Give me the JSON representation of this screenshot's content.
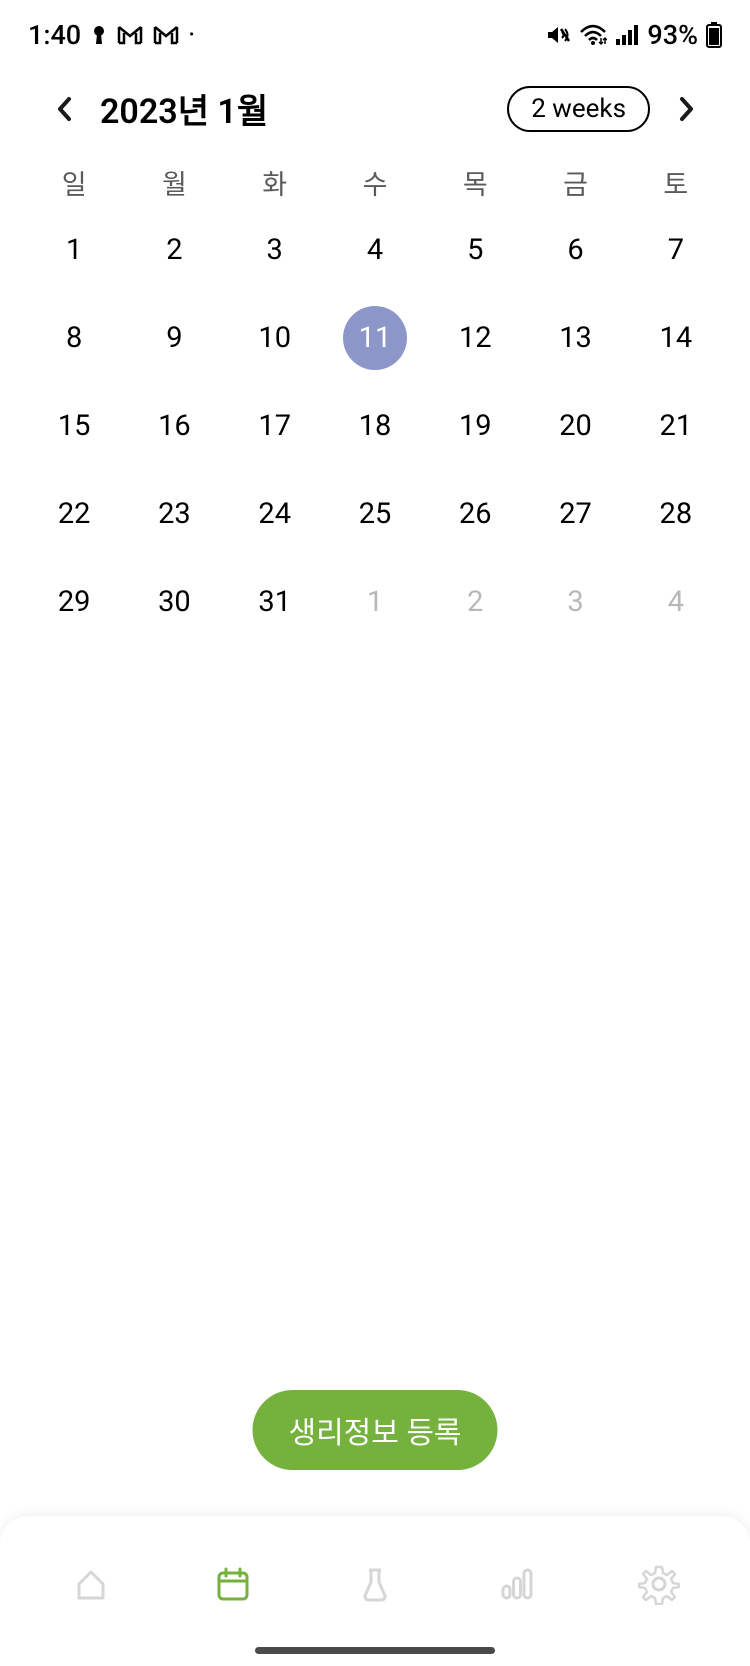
{
  "status_bar": {
    "time": "1:40",
    "battery_percent": "93%"
  },
  "calendar": {
    "month_title": "2023년 1월",
    "view_toggle_label": "2 weeks",
    "weekdays": [
      "일",
      "월",
      "화",
      "수",
      "목",
      "금",
      "토"
    ],
    "selected_day": 11,
    "days": [
      {
        "n": "1",
        "next": false
      },
      {
        "n": "2",
        "next": false
      },
      {
        "n": "3",
        "next": false
      },
      {
        "n": "4",
        "next": false
      },
      {
        "n": "5",
        "next": false
      },
      {
        "n": "6",
        "next": false
      },
      {
        "n": "7",
        "next": false
      },
      {
        "n": "8",
        "next": false
      },
      {
        "n": "9",
        "next": false
      },
      {
        "n": "10",
        "next": false
      },
      {
        "n": "11",
        "next": false
      },
      {
        "n": "12",
        "next": false
      },
      {
        "n": "13",
        "next": false
      },
      {
        "n": "14",
        "next": false
      },
      {
        "n": "15",
        "next": false
      },
      {
        "n": "16",
        "next": false
      },
      {
        "n": "17",
        "next": false
      },
      {
        "n": "18",
        "next": false
      },
      {
        "n": "19",
        "next": false
      },
      {
        "n": "20",
        "next": false
      },
      {
        "n": "21",
        "next": false
      },
      {
        "n": "22",
        "next": false
      },
      {
        "n": "23",
        "next": false
      },
      {
        "n": "24",
        "next": false
      },
      {
        "n": "25",
        "next": false
      },
      {
        "n": "26",
        "next": false
      },
      {
        "n": "27",
        "next": false
      },
      {
        "n": "28",
        "next": false
      },
      {
        "n": "29",
        "next": false
      },
      {
        "n": "30",
        "next": false
      },
      {
        "n": "31",
        "next": false
      },
      {
        "n": "1",
        "next": true
      },
      {
        "n": "2",
        "next": true
      },
      {
        "n": "3",
        "next": true
      },
      {
        "n": "4",
        "next": true
      }
    ]
  },
  "register_button_label": "생리정보 등록",
  "nav": {
    "items": [
      "home",
      "calendar",
      "lab",
      "stats",
      "settings"
    ],
    "active_index": 1
  },
  "colors": {
    "accent_green": "#74b13d",
    "selected_day": "#8d96c9",
    "nav_inactive": "#d6d6d6"
  }
}
